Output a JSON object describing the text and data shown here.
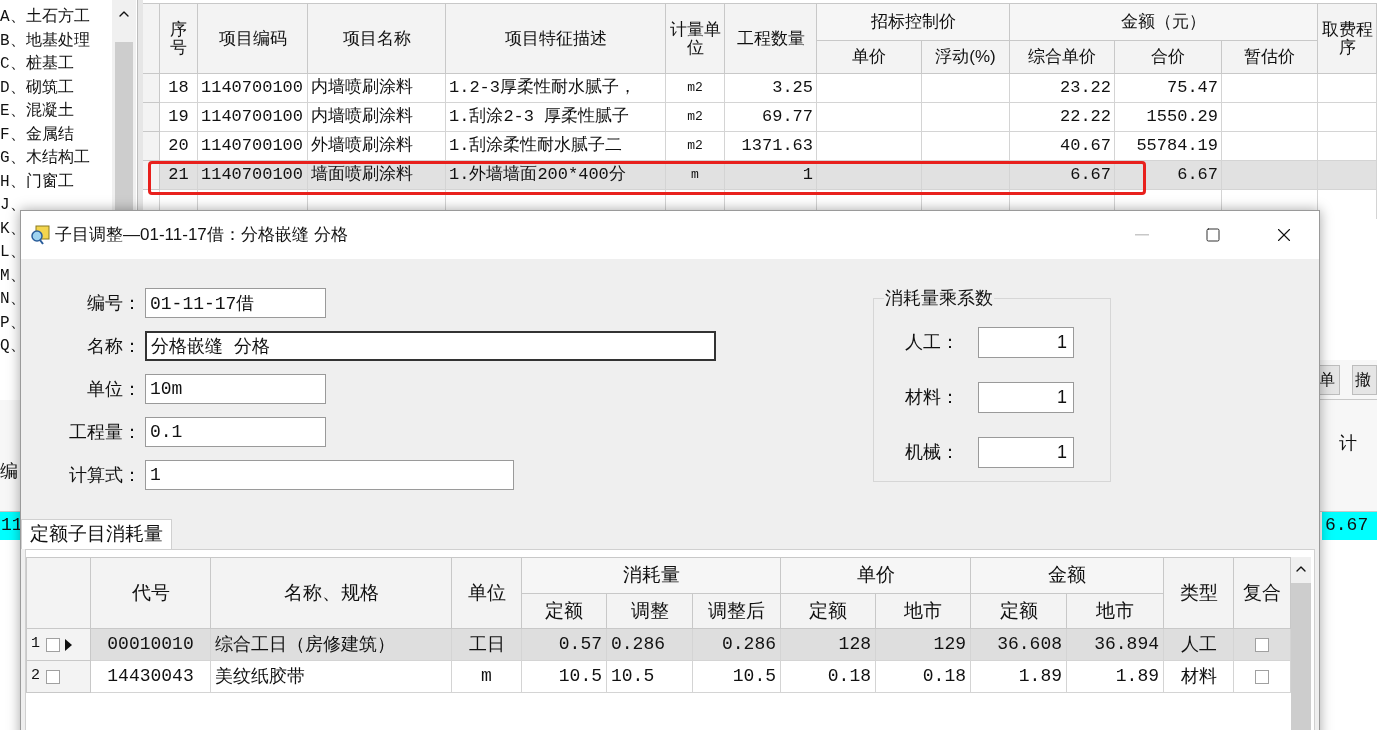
{
  "tree": {
    "items": [
      {
        "label": "A、土石方工"
      },
      {
        "label": "B、地基处理"
      },
      {
        "label": "C、桩基工"
      },
      {
        "label": "D、砌筑工"
      },
      {
        "label": "E、混凝土"
      },
      {
        "label": "F、金属结"
      },
      {
        "label": "G、木结构工"
      },
      {
        "label": "H、门窗工"
      },
      {
        "label": "J、"
      },
      {
        "label": "K、"
      },
      {
        "label": "L、"
      },
      {
        "label": "M、"
      },
      {
        "label": "N、"
      },
      {
        "label": "P、"
      },
      {
        "label": "Q、"
      }
    ]
  },
  "bill_table": {
    "header": [
      {
        "label": "序号"
      },
      {
        "label": "项目编码"
      },
      {
        "label": "项目名称"
      },
      {
        "label": "项目特征描述"
      },
      {
        "label": "计量单位"
      },
      {
        "label": "工程数量"
      },
      {
        "label": "招标控制价",
        "children": [
          {
            "label": "单价"
          },
          {
            "label": "浮动(%)"
          }
        ]
      },
      {
        "label": "金额（元）",
        "children": [
          {
            "label": "综合单价"
          },
          {
            "label": "合价"
          },
          {
            "label": "暂估价"
          }
        ]
      },
      {
        "label": "取费程序"
      }
    ],
    "rows": [
      {
        "no": "18",
        "code": "1140700100",
        "name": "内墙喷刷涂料",
        "description": "1.2-3厚柔性耐水腻子，",
        "unit": "m2",
        "quantity": "3.25",
        "composite_price": "23.22",
        "total_price": "75.47",
        "selected": false,
        "marked": false
      },
      {
        "no": "19",
        "code": "1140700100",
        "name": "内墙喷刷涂料",
        "description": "1.刮涂2-3 厚柔性腻子",
        "unit": "m2",
        "quantity": "69.77",
        "composite_price": "22.22",
        "total_price": "1550.29",
        "selected": false,
        "marked": false
      },
      {
        "no": "20",
        "code": "1140700100",
        "name": "外墙喷刷涂料",
        "description": "1.刮涂柔性耐水腻子二",
        "unit": "m2",
        "quantity": "1371.63",
        "composite_price": "40.67",
        "total_price": "55784.19",
        "selected": false,
        "marked": false
      },
      {
        "no": "21",
        "code": "1140700100",
        "name": "墙面喷刷涂料",
        "description": "1.外墙墙面200*400分",
        "unit": "m",
        "quantity": "1",
        "composite_price": "6.67",
        "total_price": "6.67",
        "selected": true,
        "marked": true
      }
    ]
  },
  "lower_panel": {
    "buttons": [
      "单",
      "撤"
    ],
    "left_header": "编",
    "right_header": "计",
    "left_cell": "11",
    "right_cell": "6.67"
  },
  "dialog": {
    "title": "子目调整—01-11-17借：分格嵌缝 分格",
    "fields": [
      {
        "label": "编号：",
        "value": "01-11-17借",
        "focused": false
      },
      {
        "label": "名称：",
        "value": "分格嵌缝 分格",
        "focused": true
      },
      {
        "label": "单位：",
        "value": "10m",
        "focused": false
      },
      {
        "label": "工程量：",
        "value": "0.1",
        "focused": false
      },
      {
        "label": "计算式：",
        "value": "1",
        "focused": false
      }
    ],
    "coefficients": {
      "title": "消耗量乘系数",
      "fields": [
        {
          "label": "人工：",
          "value": "1"
        },
        {
          "label": "材料：",
          "value": "1"
        },
        {
          "label": "机械：",
          "value": "1"
        }
      ]
    },
    "tabs": [
      {
        "label": "定额子目消耗量",
        "selected": true
      }
    ],
    "quota_table": {
      "header": [
        {
          "label": "代号"
        },
        {
          "label": "名称、规格"
        },
        {
          "label": "单位"
        },
        {
          "label": "消耗量",
          "children": [
            {
              "label": "定额"
            },
            {
              "label": "调整"
            },
            {
              "label": "调整后"
            }
          ]
        },
        {
          "label": "单价",
          "children": [
            {
              "label": "定额"
            },
            {
              "label": "地市"
            }
          ]
        },
        {
          "label": "金额",
          "children": [
            {
              "label": "定额"
            },
            {
              "label": "地市"
            }
          ]
        },
        {
          "label": "类型"
        },
        {
          "label": "复合"
        }
      ],
      "rows": [
        {
          "no": "1",
          "checked": false,
          "current": true,
          "selected": true,
          "code": "00010010",
          "name": "综合工日（房修建筑）",
          "unit": "工日",
          "quota": "0.57",
          "adjust": "0.286",
          "adjusted": "0.286",
          "price_quota": "128",
          "price_local": "129",
          "amount_quota": "36.608",
          "amount_local": "36.894",
          "type": "人工",
          "composite": false
        },
        {
          "no": "2",
          "checked": false,
          "current": false,
          "selected": false,
          "code": "14430043",
          "name": "美纹纸胶带",
          "unit": "m",
          "quota": "10.5",
          "adjust": "10.5",
          "adjusted": "10.5",
          "price_quota": "0.18",
          "price_local": "0.18",
          "amount_quota": "1.89",
          "amount_local": "1.89",
          "type": "材料",
          "composite": false
        }
      ]
    }
  }
}
